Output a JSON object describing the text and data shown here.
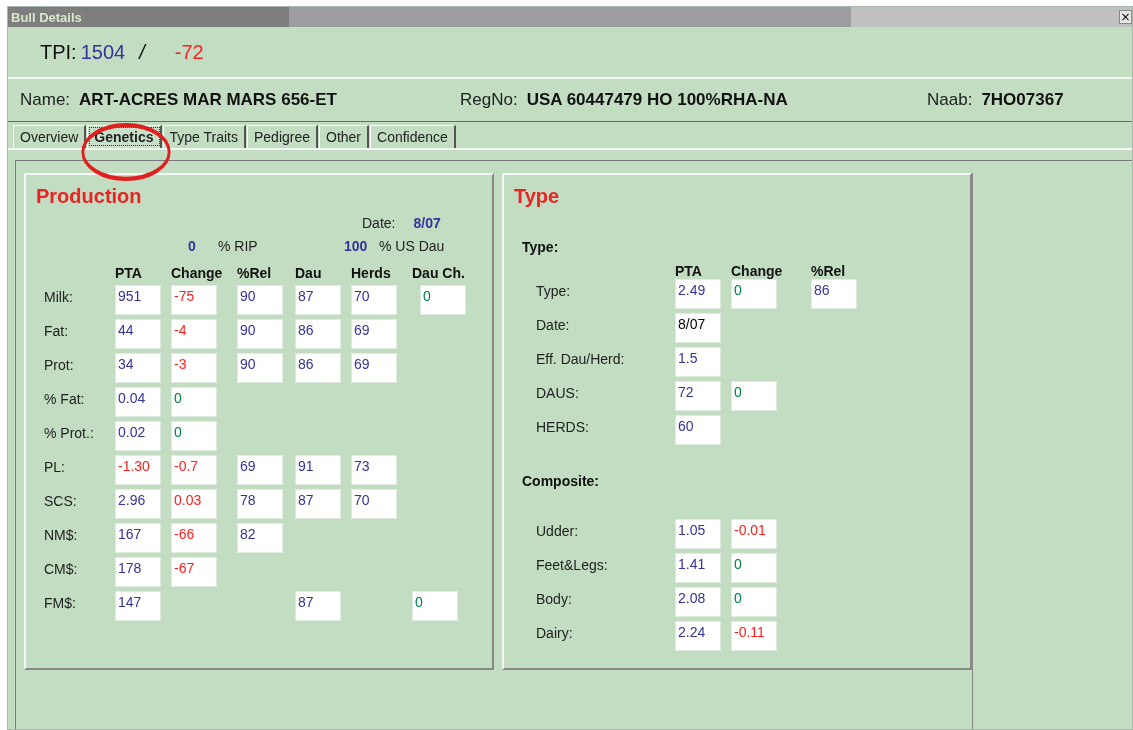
{
  "window": {
    "title": "Bull Details",
    "close": "×"
  },
  "tpi": {
    "label": "TPI:",
    "value": "1504",
    "separator": "/",
    "change": "-72"
  },
  "identity": [
    {
      "label": "Name:",
      "value": "ART-ACRES MAR MARS 656-ET"
    },
    {
      "label": "RegNo:",
      "value": "USA 60447479 HO 100%RHA-NA"
    },
    {
      "label": "Naab:",
      "value": "7HO07367"
    }
  ],
  "tabs": [
    {
      "label": "Overview",
      "selected": false
    },
    {
      "label": "Genetics",
      "selected": true
    },
    {
      "label": "Type Traits",
      "selected": false
    },
    {
      "label": "Pedigree",
      "selected": false
    },
    {
      "label": "Other",
      "selected": false
    },
    {
      "label": "Confidence",
      "selected": false
    }
  ],
  "annotation": {
    "kind": "circle",
    "color": "#e02020"
  },
  "production": {
    "title": "Production",
    "date_label": "Date:",
    "date": "8/07",
    "rip_value": "0",
    "rip_label": "% RIP",
    "usdau_value": "100",
    "usdau_label": "% US Dau",
    "columns": [
      "PTA",
      "Change",
      "%Rel",
      "Dau",
      "Herds",
      "Dau Ch."
    ],
    "rows": [
      {
        "label": "Milk:",
        "cells": [
          {
            "value": "951",
            "color": "#333399"
          },
          {
            "value": "-75",
            "color": "#ff2020"
          },
          {
            "value": "90",
            "color": "#333399"
          },
          {
            "value": "87",
            "color": "#333399"
          },
          {
            "value": "70",
            "color": "#333399"
          },
          {
            "value": "0",
            "color": "#008040"
          }
        ]
      },
      {
        "label": "Fat:",
        "cells": [
          {
            "value": "44",
            "color": "#333399"
          },
          {
            "value": "-4",
            "color": "#ff2020"
          },
          {
            "value": "90",
            "color": "#333399"
          },
          {
            "value": "86",
            "color": "#333399"
          },
          {
            "value": "69",
            "color": "#333399"
          },
          {}
        ]
      },
      {
        "label": "Prot:",
        "cells": [
          {
            "value": "34",
            "color": "#333399"
          },
          {
            "value": "-3",
            "color": "#ff2020"
          },
          {
            "value": "90",
            "color": "#333399"
          },
          {
            "value": "86",
            "color": "#333399"
          },
          {
            "value": "69",
            "color": "#333399"
          },
          {}
        ]
      },
      {
        "label": "% Fat:",
        "cells": [
          {
            "value": "0.04",
            "color": "#333399"
          },
          {
            "value": "0",
            "color": "#008040"
          },
          {},
          {},
          {},
          {}
        ]
      },
      {
        "label": "% Prot.:",
        "cells": [
          {
            "value": "0.02",
            "color": "#333399"
          },
          {
            "value": "0",
            "color": "#008040"
          },
          {},
          {},
          {},
          {}
        ]
      },
      {
        "label": "PL:",
        "cells": [
          {
            "value": "-1.30",
            "color": "#ff2020"
          },
          {
            "value": "-0.7",
            "color": "#ff2020"
          },
          {
            "value": "69",
            "color": "#333399"
          },
          {
            "value": "91",
            "color": "#333399"
          },
          {
            "value": "73",
            "color": "#333399"
          },
          {}
        ]
      },
      {
        "label": "SCS:",
        "cells": [
          {
            "value": "2.96",
            "color": "#333399"
          },
          {
            "value": "0.03",
            "color": "#ff2020"
          },
          {
            "value": "78",
            "color": "#333399"
          },
          {
            "value": "87",
            "color": "#333399"
          },
          {
            "value": "70",
            "color": "#333399"
          },
          {}
        ]
      },
      {
        "label": "NM$:",
        "cells": [
          {
            "value": "167",
            "color": "#333399"
          },
          {
            "value": "-66",
            "color": "#ff2020"
          },
          {
            "value": "82",
            "color": "#333399"
          },
          {},
          {},
          {}
        ]
      },
      {
        "label": "CM$:",
        "cells": [
          {
            "value": "178",
            "color": "#333399"
          },
          {
            "value": "-67",
            "color": "#ff2020"
          },
          {},
          {},
          {},
          {}
        ]
      },
      {
        "label": "FM$:",
        "cells": [
          {
            "value": "147",
            "color": "#333399"
          },
          {},
          {},
          {
            "value": "87",
            "color": "#333399"
          },
          {},
          {
            "value": "0",
            "color": "#008040"
          }
        ]
      }
    ]
  },
  "type": {
    "title": "Type",
    "sections": [
      {
        "heading": "Type:",
        "columns": [
          "PTA",
          "Change",
          "%Rel"
        ],
        "rows": [
          {
            "label": "Type:",
            "cells": [
              {
                "value": "2.49",
                "color": "#333399"
              },
              {
                "value": "0",
                "color": "#008040"
              },
              {
                "value": "86",
                "color": "#333399"
              }
            ]
          },
          {
            "label": "Date:",
            "cells": [
              {
                "value": "8/07",
                "color": "#000000"
              },
              {},
              {}
            ]
          },
          {
            "label": "Eff. Dau/Herd:",
            "cells": [
              {
                "value": "1.5",
                "color": "#333399"
              },
              {},
              {}
            ]
          },
          {
            "label": "DAUS:",
            "cells": [
              {
                "value": "72",
                "color": "#333399"
              },
              {
                "value": "0",
                "color": "#008040"
              },
              {}
            ]
          },
          {
            "label": "HERDS:",
            "cells": [
              {
                "value": "60",
                "color": "#333399"
              },
              {},
              {}
            ]
          }
        ]
      },
      {
        "heading": "Composite:",
        "rows": [
          {
            "label": "Udder:",
            "cells": [
              {
                "value": "1.05",
                "color": "#333399"
              },
              {
                "value": "-0.01",
                "color": "#ff2020"
              },
              {}
            ]
          },
          {
            "label": "Feet&Legs:",
            "cells": [
              {
                "value": "1.41",
                "color": "#333399"
              },
              {
                "value": "0",
                "color": "#008040"
              },
              {}
            ]
          },
          {
            "label": "Body:",
            "cells": [
              {
                "value": "2.08",
                "color": "#333399"
              },
              {
                "value": "0",
                "color": "#008040"
              },
              {}
            ]
          },
          {
            "label": "Dairy:",
            "cells": [
              {
                "value": "2.24",
                "color": "#333399"
              },
              {
                "value": "-0.11",
                "color": "#ff2020"
              },
              {}
            ]
          }
        ]
      }
    ]
  }
}
